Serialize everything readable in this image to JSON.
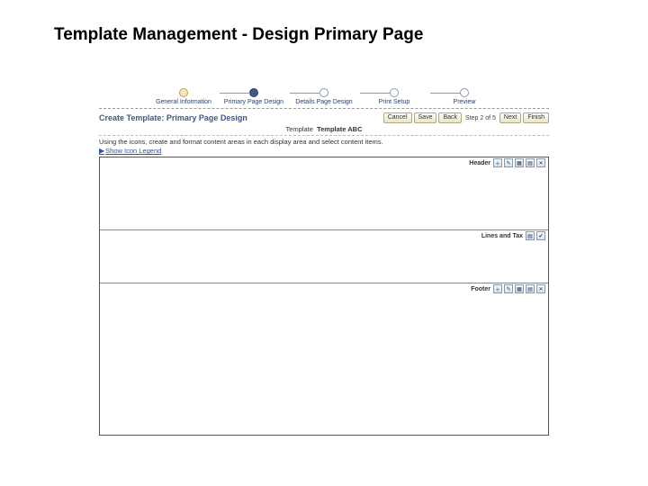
{
  "slide_title": "Template Management - Design Primary Page",
  "wizard": {
    "steps": [
      {
        "label": "General Information"
      },
      {
        "label": "Primary Page Design"
      },
      {
        "label": "Details Page Design"
      },
      {
        "label": "Print Setup"
      },
      {
        "label": "Preview"
      }
    ]
  },
  "page_heading": "Create Template: Primary Page Design",
  "buttons": {
    "cancel": "Cancel",
    "save": "Save",
    "back": "Back",
    "step_text": "Step 2 of 5",
    "next": "Next",
    "finish": "Finish"
  },
  "template_line": {
    "label": "Template",
    "value": "Template ABC"
  },
  "instruction": "Using the icons, create and format content areas in each display area and select content items.",
  "legend_link": "Show Icon Legend",
  "regions": {
    "header": {
      "name": "Header"
    },
    "lines": {
      "name": "Lines and Tax"
    },
    "footer": {
      "name": "Footer"
    }
  },
  "icon_glyphs": {
    "add": "＋",
    "edit": "✎",
    "layout": "▦",
    "grid": "▤",
    "delete": "✕",
    "check": "✔"
  }
}
